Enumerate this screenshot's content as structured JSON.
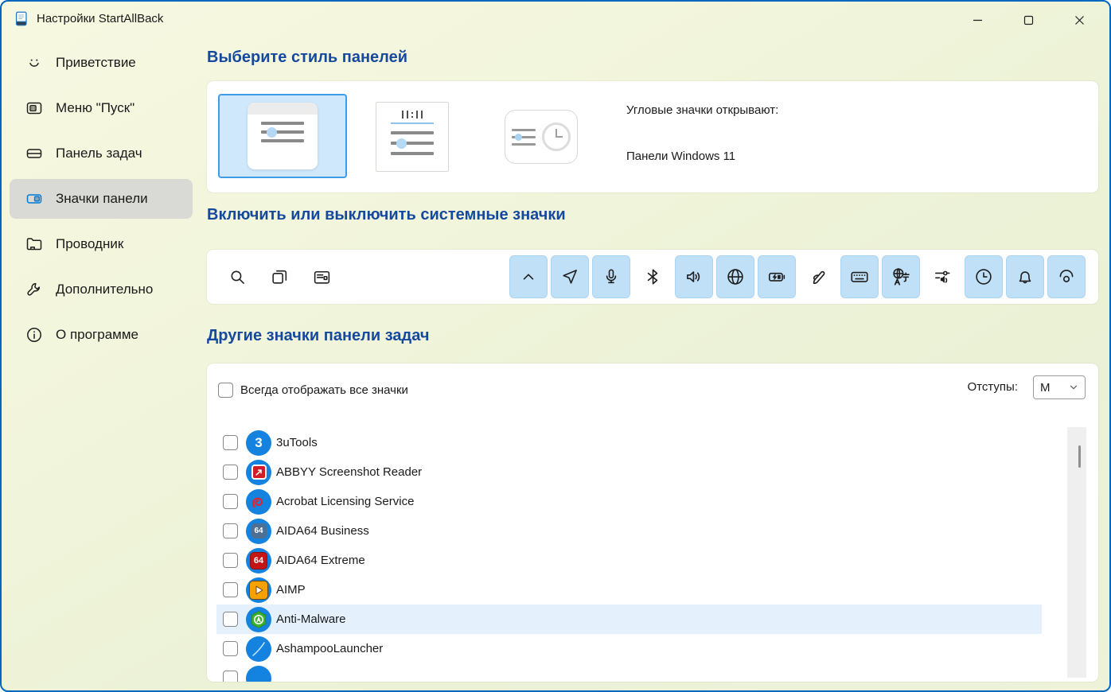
{
  "window": {
    "title": "Настройки StartAllBack",
    "controls": [
      {
        "name": "minimize"
      },
      {
        "name": "maximize"
      },
      {
        "name": "close"
      }
    ]
  },
  "sidebar": {
    "items": [
      {
        "name": "welcome",
        "icon": "smiley",
        "label": "Приветствие",
        "selected": false
      },
      {
        "name": "start-menu",
        "icon": "startmenu",
        "label": "Меню \"Пуск\"",
        "selected": false
      },
      {
        "name": "taskbar",
        "icon": "taskbarico",
        "label": "Панель задач",
        "selected": false
      },
      {
        "name": "tray-icons",
        "icon": "tray",
        "label": "Значки панели",
        "selected": true
      },
      {
        "name": "explorer",
        "icon": "folder",
        "label": "Проводник",
        "selected": false
      },
      {
        "name": "advanced",
        "icon": "wrench",
        "label": "Дополнительно",
        "selected": false
      },
      {
        "name": "about",
        "icon": "info",
        "label": "О программе",
        "selected": false
      }
    ]
  },
  "sections": {
    "style": {
      "title": "Выберите стиль панелей",
      "tiles": [
        {
          "name": "windows-11-style",
          "selected": true
        },
        {
          "name": "windows-10-style",
          "selected": false
        },
        {
          "name": "compact-clock-style",
          "selected": false
        }
      ],
      "corner_label": "Угловые значки открывают:",
      "corner_value": "Панели Windows 11"
    },
    "system_icons": {
      "title": "Включить или выключить системные значки",
      "taskbar_left_icons": [
        "search",
        "task-view",
        "widgets"
      ],
      "toggles": [
        {
          "icon": "chevron-up",
          "enabled": true
        },
        {
          "icon": "location",
          "enabled": true
        },
        {
          "icon": "microphone",
          "enabled": true
        },
        {
          "icon": "bluetooth",
          "enabled": false
        },
        {
          "icon": "volume",
          "enabled": true
        },
        {
          "icon": "network-globe",
          "enabled": true
        },
        {
          "icon": "battery",
          "enabled": true
        },
        {
          "icon": "pen",
          "enabled": false
        },
        {
          "icon": "touch-keyboard",
          "enabled": true
        },
        {
          "icon": "language",
          "enabled": true
        },
        {
          "icon": "volume-mixer",
          "enabled": false
        },
        {
          "icon": "clock",
          "enabled": true
        },
        {
          "icon": "bell",
          "enabled": true
        },
        {
          "icon": "eye",
          "enabled": true
        }
      ]
    },
    "other_icons": {
      "title": "Другие значки панели задач",
      "always_show": {
        "label": "Всегда отображать все значки",
        "checked": false
      },
      "spacing": {
        "label": "Отступы:",
        "value": "M"
      },
      "apps": [
        {
          "label": "3uTools",
          "icon": "3utools",
          "checked": false,
          "highlighted": false
        },
        {
          "label": "ABBYY Screenshot Reader",
          "icon": "abbyy",
          "checked": false,
          "highlighted": false
        },
        {
          "label": "Acrobat Licensing Service",
          "icon": "acrobat",
          "checked": false,
          "highlighted": false
        },
        {
          "label": "AIDA64 Business",
          "icon": "aida64-business",
          "checked": false,
          "highlighted": false
        },
        {
          "label": "AIDA64 Extreme",
          "icon": "aida64-extreme",
          "checked": false,
          "highlighted": false
        },
        {
          "label": "AIMP",
          "icon": "aimp",
          "checked": false,
          "highlighted": false
        },
        {
          "label": "Anti-Malware",
          "icon": "anti-malware",
          "checked": false,
          "highlighted": true
        },
        {
          "label": "AshampooLauncher",
          "icon": "ashampoo",
          "checked": false,
          "highlighted": false
        },
        {
          "label": "",
          "icon": "partial-blue",
          "checked": false,
          "highlighted": false,
          "partial": true
        }
      ]
    }
  },
  "colors": {
    "accent_border": "#0067c0",
    "header_blue": "#15499e",
    "sidebar_selected_bg": "#d9d9d5",
    "tile_selected_bg": "#cfe8fb",
    "tile_selected_border": "#3f9ce9",
    "toggle_bg": "#c0e0f8",
    "row_highlight": "#e4f1fc",
    "app_circle_blue": "#1483e0",
    "background_tint": "#f1f5db"
  }
}
